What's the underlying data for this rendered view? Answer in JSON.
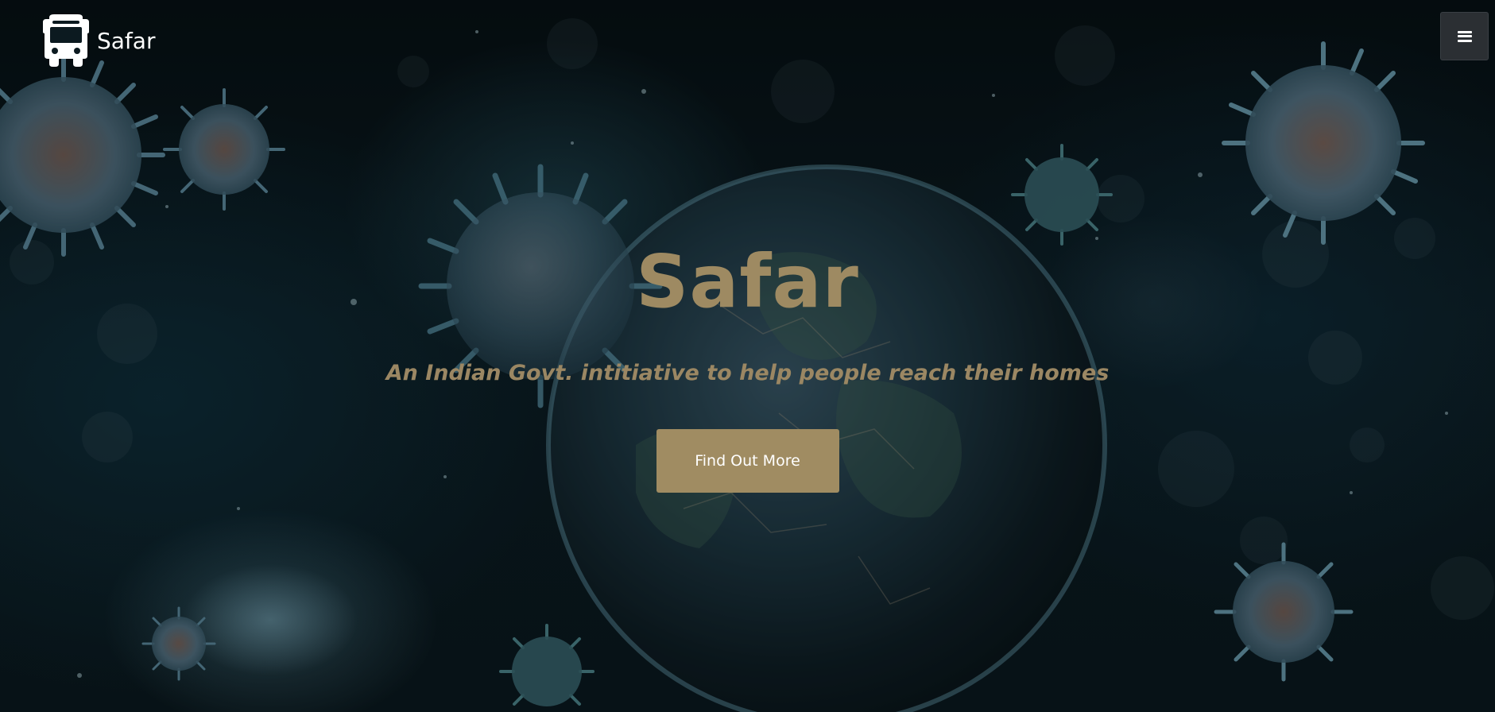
{
  "brand": {
    "name": "Safar",
    "icon": "bus-icon"
  },
  "nav": {
    "menu_icon": "hamburger-menu-icon"
  },
  "hero": {
    "title": "Safar",
    "subtitle": "An Indian Govt. intitiative to help people reach their homes",
    "cta_label": "Find Out More"
  },
  "colors": {
    "accent": "#a08c62",
    "title_text": "#9e8a62",
    "menu_button_bg": "#2b2f33",
    "background": "#0a1418"
  },
  "background_image": {
    "subject": "earth-with-virus-particles"
  }
}
